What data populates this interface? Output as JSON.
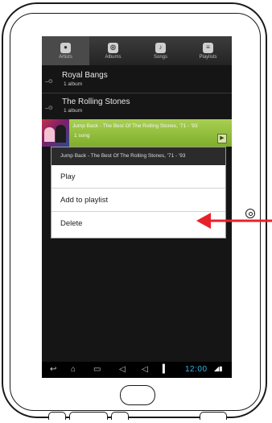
{
  "tabs": [
    {
      "label": "Artists",
      "icon": "mic-icon",
      "active": true
    },
    {
      "label": "Albums",
      "icon": "album-icon",
      "active": false
    },
    {
      "label": "Songs",
      "icon": "note-icon",
      "active": false
    },
    {
      "label": "Playlists",
      "icon": "list-icon",
      "active": false
    }
  ],
  "artists": [
    {
      "name": "Royal Bangs",
      "count": "1 album"
    },
    {
      "name": "The Rolling Stones",
      "count": "1 album"
    }
  ],
  "album": {
    "title": "Jump Back - The Best Of The Rolling Stones, '71 - '93",
    "count": "1 song"
  },
  "context_menu": {
    "header": "Jump Back - The Best Of The Rolling Stones, '71 - '93",
    "items": [
      "Play",
      "Add to playlist",
      "Delete"
    ]
  },
  "status": {
    "time": "12:00"
  },
  "colors": {
    "album_highlight": "#94c043",
    "clock": "#2fb6e8",
    "arrow": "#e8202a"
  }
}
